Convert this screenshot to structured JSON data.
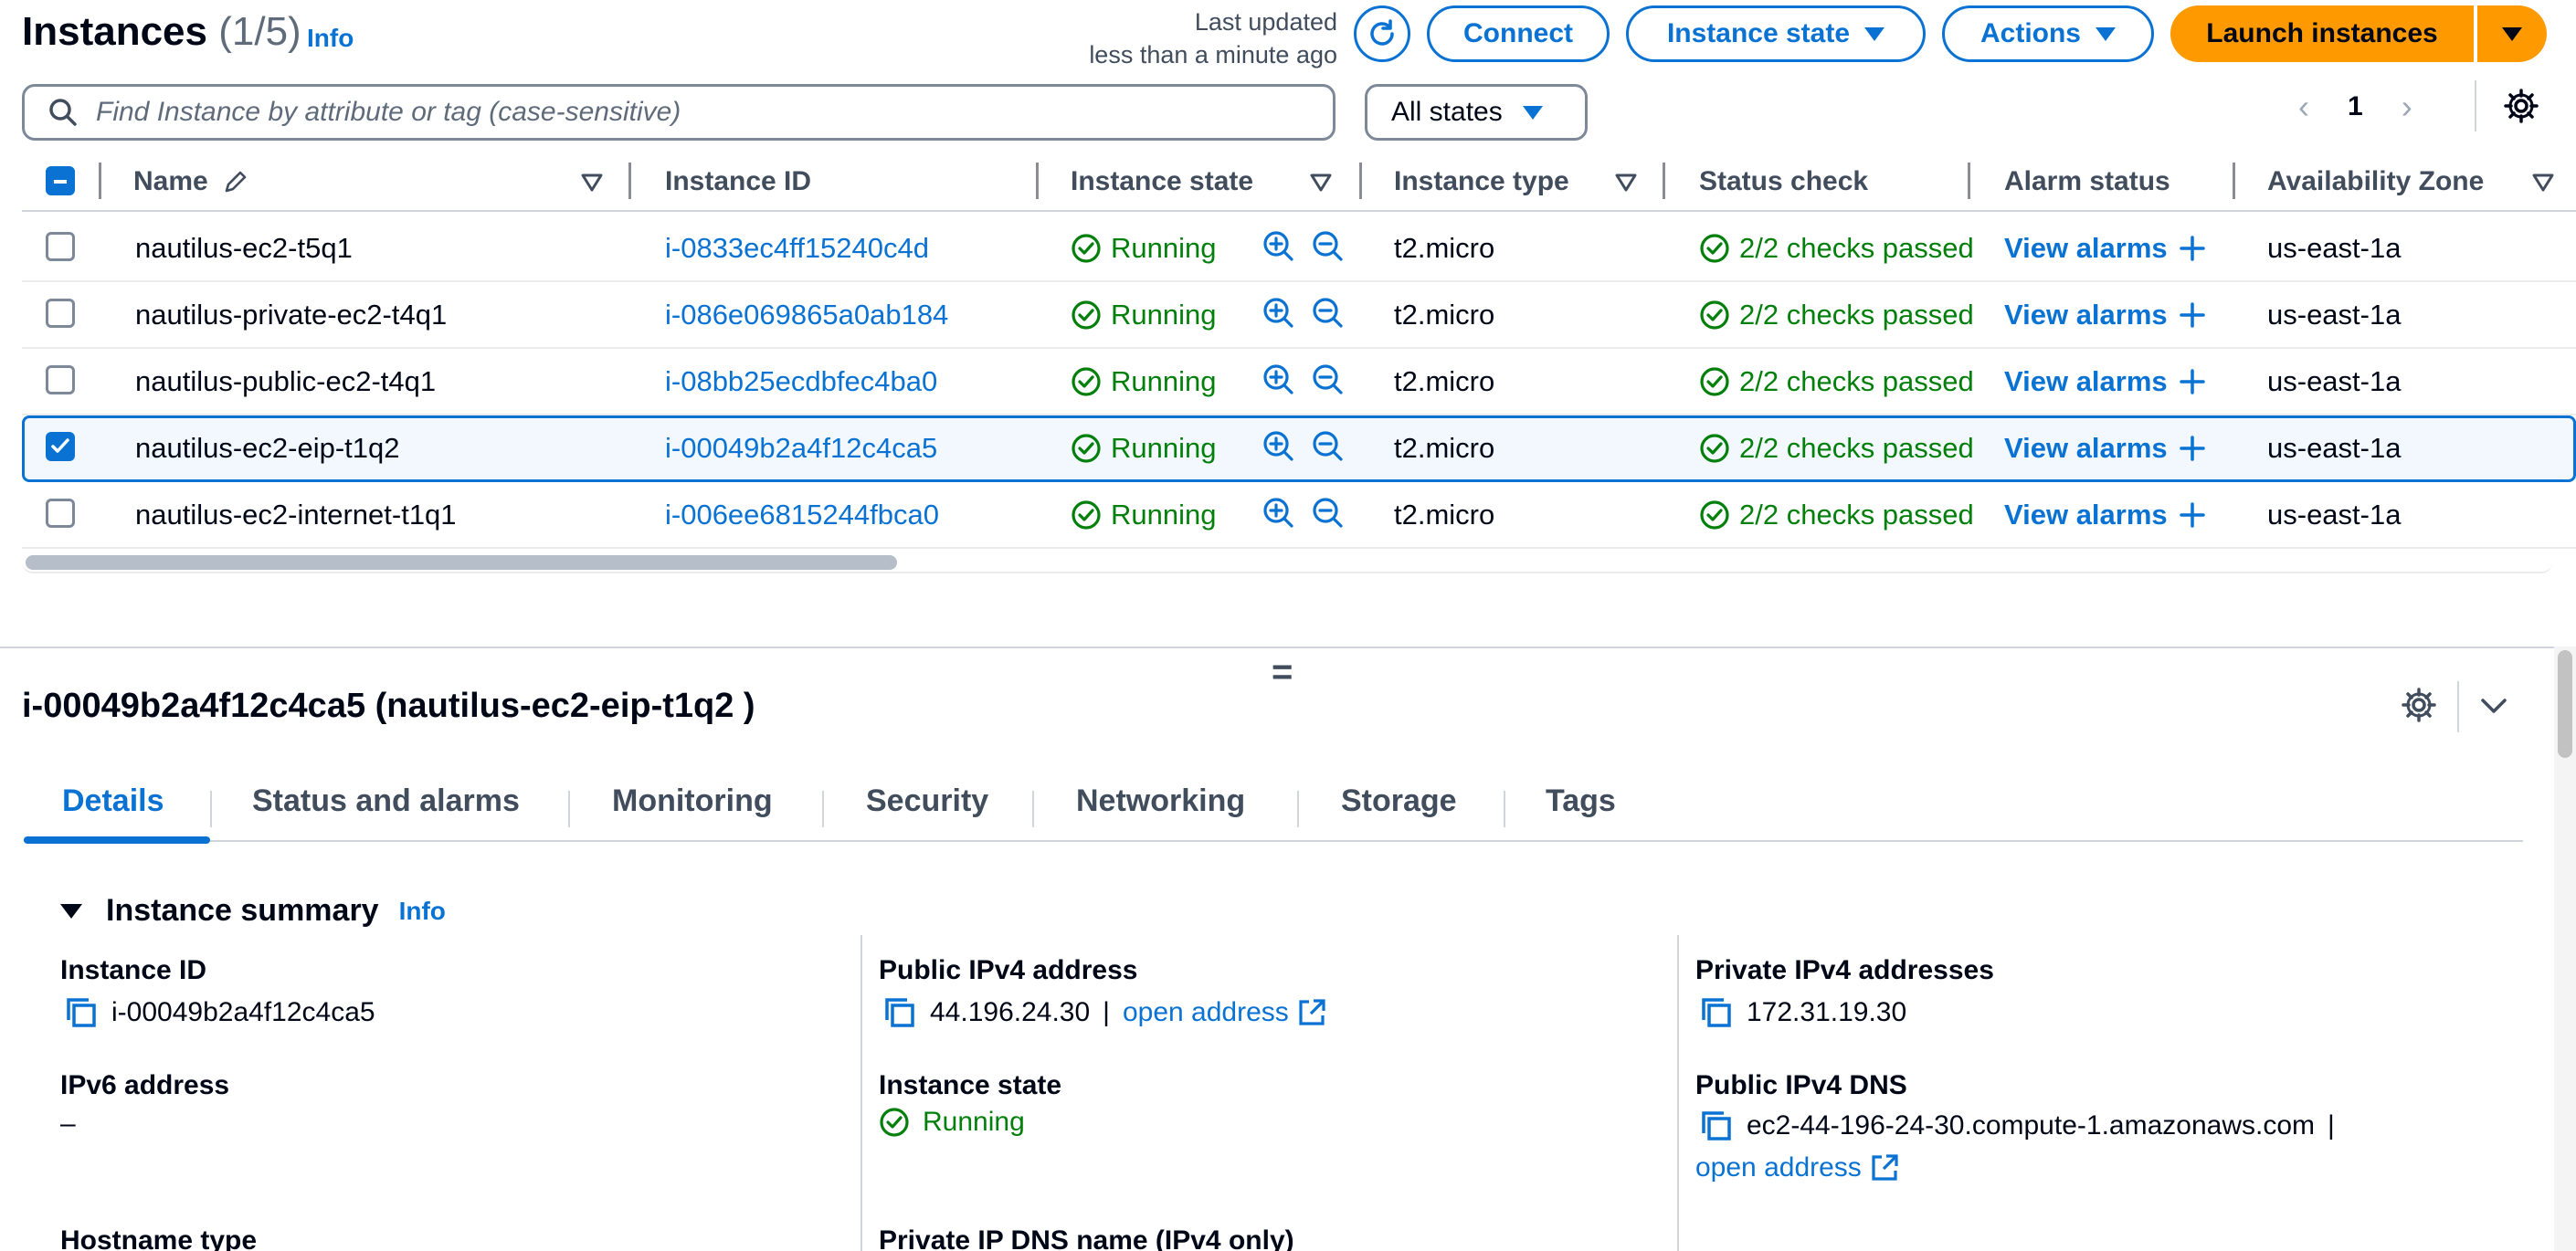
{
  "header": {
    "title": "Instances",
    "count": "(1/5)",
    "info": "Info",
    "last_updated_line1": "Last updated",
    "last_updated_line2": "less than a minute ago",
    "connect": "Connect",
    "instance_state": "Instance state",
    "actions": "Actions",
    "launch": "Launch instances"
  },
  "filter": {
    "search_placeholder": "Find Instance by attribute or tag (case-sensitive)",
    "states": "All states",
    "page": "1"
  },
  "table": {
    "columns": [
      "Name",
      "Instance ID",
      "Instance state",
      "Instance type",
      "Status check",
      "Alarm status",
      "Availability Zone"
    ],
    "rows": [
      {
        "name": "nautilus-ec2-t5q1",
        "id": "i-0833ec4ff15240c4d",
        "state": "Running",
        "type": "t2.micro",
        "status": "2/2 checks passed",
        "alarm": "View alarms",
        "az": "us-east-1a",
        "selected": false
      },
      {
        "name": "nautilus-private-ec2-t4q1",
        "id": "i-086e069865a0ab184",
        "state": "Running",
        "type": "t2.micro",
        "status": "2/2 checks passed",
        "alarm": "View alarms",
        "az": "us-east-1a",
        "selected": false
      },
      {
        "name": "nautilus-public-ec2-t4q1",
        "id": "i-08bb25ecdbfec4ba0",
        "state": "Running",
        "type": "t2.micro",
        "status": "2/2 checks passed",
        "alarm": "View alarms",
        "az": "us-east-1a",
        "selected": false
      },
      {
        "name": "nautilus-ec2-eip-t1q2",
        "id": "i-00049b2a4f12c4ca5",
        "state": "Running",
        "type": "t2.micro",
        "status": "2/2 checks passed",
        "alarm": "View alarms",
        "az": "us-east-1a",
        "selected": true
      },
      {
        "name": "nautilus-ec2-internet-t1q1",
        "id": "i-006ee6815244fbca0",
        "state": "Running",
        "type": "t2.micro",
        "status": "2/2 checks passed",
        "alarm": "View alarms",
        "az": "us-east-1a",
        "selected": false
      }
    ]
  },
  "details": {
    "title": "i-00049b2a4f12c4ca5 (nautilus-ec2-eip-t1q2 )",
    "tabs": [
      "Details",
      "Status and alarms",
      "Monitoring",
      "Security",
      "Networking",
      "Storage",
      "Tags"
    ],
    "summary_title": "Instance summary",
    "summary_info": "Info",
    "instance_id_label": "Instance ID",
    "instance_id": "i-00049b2a4f12c4ca5",
    "ipv6_label": "IPv6 address",
    "ipv6": "–",
    "hostname_label": "Hostname type",
    "public_ipv4_label": "Public IPv4 address",
    "public_ipv4": "44.196.24.30",
    "open_address": "open address",
    "state_label": "Instance state",
    "state": "Running",
    "private_dns_label": "Private IP DNS name (IPv4 only)",
    "private_ipv4_label": "Private IPv4 addresses",
    "private_ipv4": "172.31.19.30",
    "public_dns_label": "Public IPv4 DNS",
    "public_dns": "ec2-44-196-24-30.compute-1.amazonaws.com",
    "open_address2": "open address"
  },
  "colors": {
    "accent": "#0972d3",
    "success": "#037f0c",
    "launch": "#ff9900"
  }
}
